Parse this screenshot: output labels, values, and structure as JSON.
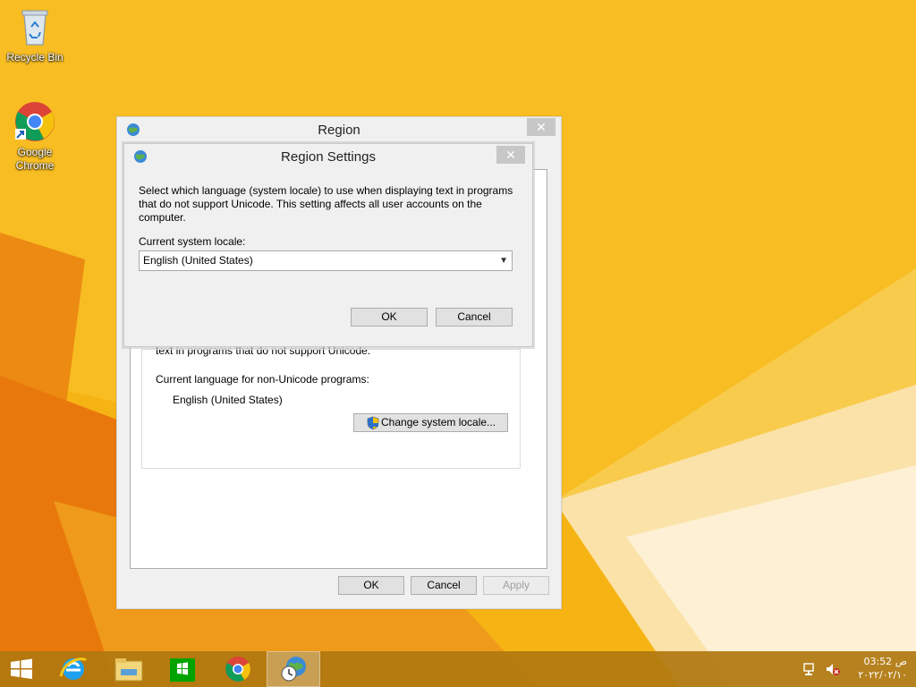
{
  "desktop": {
    "icons": [
      {
        "label": "Recycle Bin"
      },
      {
        "label": "Google Chrome"
      }
    ]
  },
  "region_window": {
    "title": "Region",
    "close_label": "✕",
    "partial_text": "text in programs that do not support Unicode.",
    "current_lang_label": "Current language for non-Unicode programs:",
    "current_lang_value": "English (United States)",
    "change_locale_button": "Change system locale...",
    "ok_button": "OK",
    "cancel_button": "Cancel",
    "apply_button": "Apply"
  },
  "region_settings_dialog": {
    "title": "Region Settings",
    "close_label": "✕",
    "description": "Select which language (system locale) to use when displaying text in programs that do not support Unicode. This setting affects all user accounts on the computer.",
    "locale_label": "Current system locale:",
    "locale_value": "English (United States)",
    "ok_button": "OK",
    "cancel_button": "Cancel"
  },
  "taskbar": {
    "items": [
      "start-button",
      "internet-explorer-icon",
      "file-explorer-icon",
      "store-icon",
      "chrome-icon",
      "region-icon"
    ],
    "clock_time": "03:52 ص",
    "clock_date": "٢٠٢٢/٠٢/١٠"
  }
}
